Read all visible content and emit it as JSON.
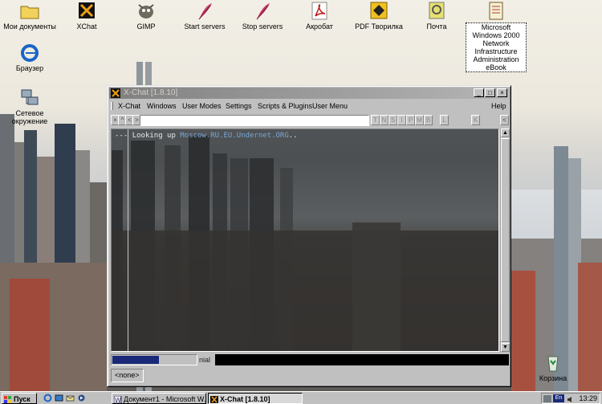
{
  "desktop": {
    "icons": [
      {
        "label": "Мои документы"
      },
      {
        "label": "XChat"
      },
      {
        "label": "GIMP"
      },
      {
        "label": "Start servers"
      },
      {
        "label": "Stop servers"
      },
      {
        "label": "Акробат"
      },
      {
        "label": "PDF Творилка"
      },
      {
        "label": "Почта"
      },
      {
        "label": "Microsoft Windows 2000 Network Infrastructure Administration eBook"
      },
      {
        "label": "Браузер"
      },
      {
        "label": "Сетевое окружение"
      },
      {
        "label": "Корзина"
      }
    ]
  },
  "window": {
    "title": "X-Chat [1.8.10]",
    "controls": {
      "minimize": "_",
      "maximize": "□",
      "close": "×"
    },
    "menu": [
      "X-Chat",
      "Windows",
      "User Modes",
      "Settings",
      "Scripts & Plugins",
      "User Menu",
      "Help"
    ],
    "toolbar": {
      "nav_buttons": [
        "×",
        "^",
        "<",
        ">"
      ],
      "topic_value": "",
      "mode_buttons": [
        "T",
        "N",
        "S",
        "I",
        "P",
        "M",
        "B",
        "L",
        "K"
      ],
      "end_button": "<"
    },
    "chat": {
      "prefix": "---",
      "message": "Looking up ",
      "host": "Moscow.RU.EU.Undernet.ORG",
      "suffix": ".."
    },
    "status": {
      "label": "nial",
      "lag_level": 0.55
    },
    "channel_tab": "<none>"
  },
  "taskbar": {
    "start_label": "Пуск",
    "quick_launch": [
      "ie-icon",
      "desktop-icon",
      "outlook-icon",
      "media-icon"
    ],
    "tasks": [
      {
        "label": "Документ1 - Microsoft W...",
        "active": false
      },
      {
        "label": "X-Chat [1.8.10]",
        "active": true
      }
    ],
    "tray": {
      "language": "En",
      "clock": "13:29"
    }
  },
  "colors": {
    "window_face": "#c0c0c0",
    "inactive_title": "#808080",
    "chat_host": "#7ba6d4",
    "lag_fill": "#1a2a78"
  }
}
